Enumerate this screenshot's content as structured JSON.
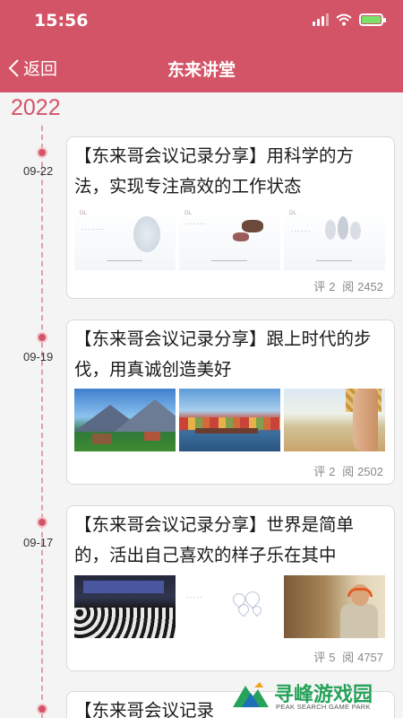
{
  "status_bar": {
    "time": "15:56"
  },
  "nav": {
    "back_label": "返回",
    "title": "东来讲堂"
  },
  "timeline": {
    "year": "2022"
  },
  "articles": [
    {
      "date": "09-22",
      "title": "【东来哥会议记录分享】用科学的方法，实现专注高效的工作状态",
      "comments_label": "评",
      "comments": "2",
      "views_label": "阅",
      "views": "2452"
    },
    {
      "date": "09-19",
      "title": "【东来哥会议记录分享】跟上时代的步伐，用真诚创造美好",
      "comments_label": "评",
      "comments": "2",
      "views_label": "阅",
      "views": "2502"
    },
    {
      "date": "09-17",
      "title": "【东来哥会议记录分享】世界是简单的，活出自己喜欢的样子乐在其中",
      "comments_label": "评",
      "comments": "5",
      "views_label": "阅",
      "views": "4757"
    },
    {
      "title": "【东来哥会议记录"
    }
  ],
  "watermark": {
    "title": "寻峰游戏园",
    "subtitle": "PEAK SEARCH GAME PARK"
  },
  "colors": {
    "accent": "#d35467",
    "battery": "#7ce06a",
    "watermark": "#27a25a"
  },
  "icons": [
    "signal-icon",
    "wifi-icon",
    "battery-icon",
    "back-chevron-icon"
  ]
}
